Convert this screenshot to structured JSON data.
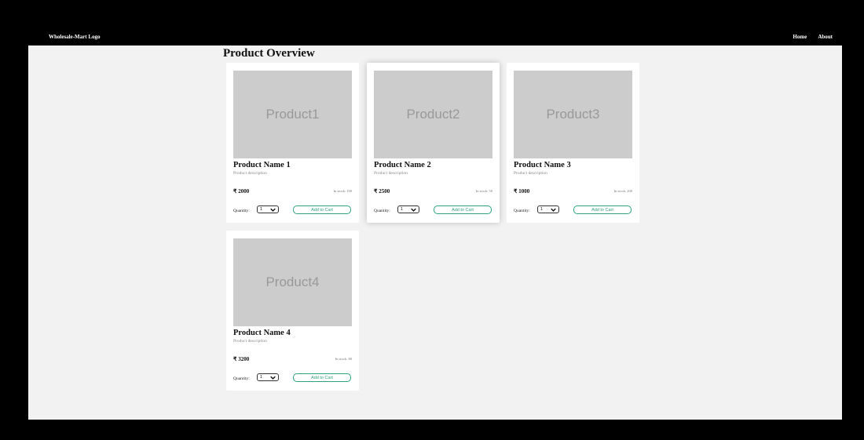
{
  "navbar": {
    "logo": "Wholesale-Mart Logo",
    "links": [
      "Home",
      "About"
    ]
  },
  "page": {
    "title": "Product Overview"
  },
  "products": [
    {
      "image_label": "Product1",
      "name": "Product Name 1",
      "description": "Product description",
      "price": "₹ 2000",
      "stock": "In stock: 100",
      "quantity": "1",
      "button": "Add to Cart"
    },
    {
      "image_label": "Product2",
      "name": "Product Name 2",
      "description": "Product description",
      "price": "₹ 2500",
      "stock": "In stock: 50",
      "quantity": "1",
      "button": "Add to Cart"
    },
    {
      "image_label": "Product3",
      "name": "Product Name 3",
      "description": "Product description",
      "price": "₹ 1000",
      "stock": "In stock: 200",
      "quantity": "1",
      "button": "Add to Cart"
    },
    {
      "image_label": "Product4",
      "name": "Product Name 4",
      "description": "Product description",
      "price": "₹ 3200",
      "stock": "In stock: 80",
      "quantity": "1",
      "button": "Add to Cart"
    }
  ],
  "labels": {
    "quantity": "Quantity:"
  },
  "colors": {
    "accent": "#2ea37a",
    "image_placeholder": "#cccccc",
    "page_background": "#f2f2f2"
  },
  "icons": {
    "select_arrow": "chevron-down-icon"
  }
}
